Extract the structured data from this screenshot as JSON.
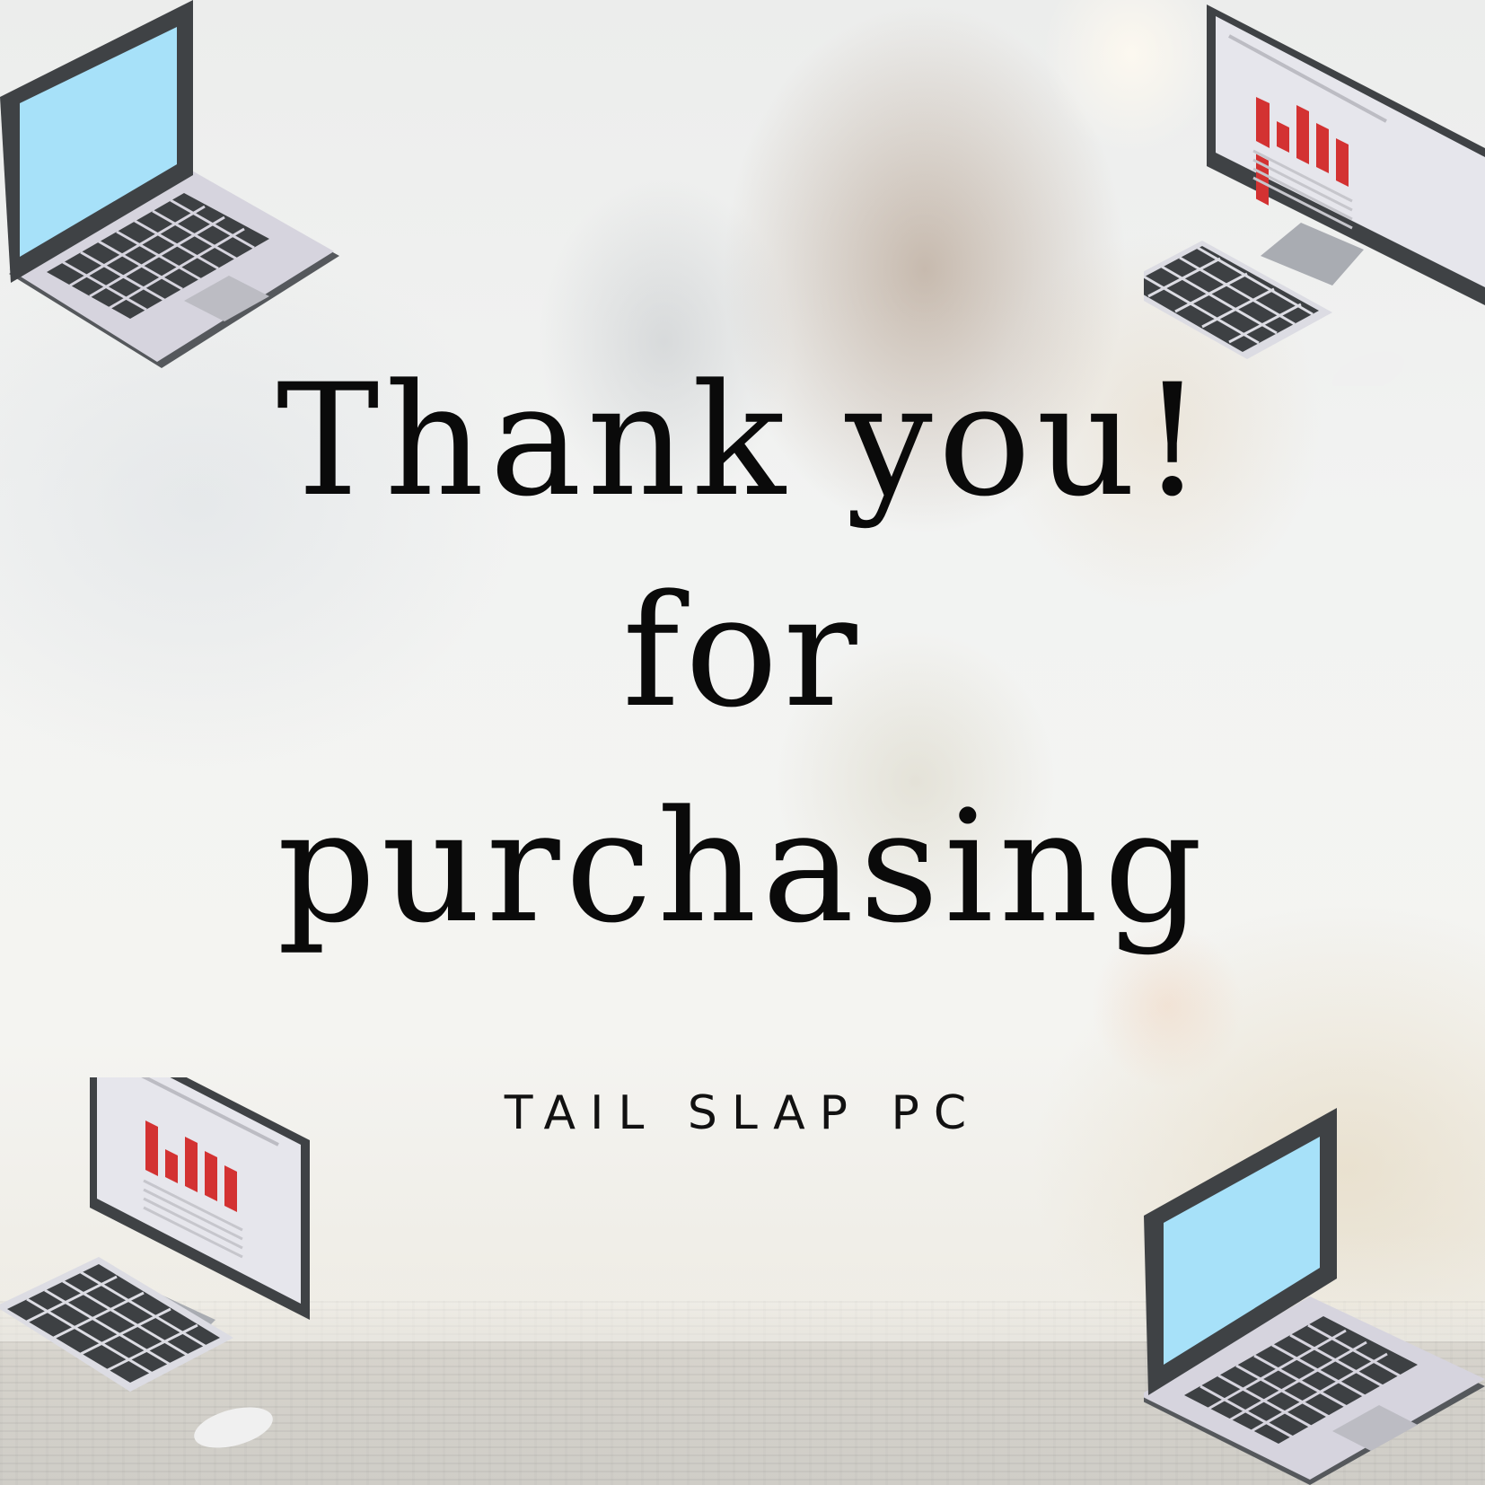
{
  "message": {
    "line1": "Thank you!",
    "line2": "for",
    "line3": "purchasing"
  },
  "brand": "TAIL SLAP PC",
  "colors": {
    "text": "#0a0a0a",
    "laptop_screen": "#a7e1f9",
    "bezel": "#3f4245",
    "chart_bar": "#d33232"
  },
  "illustrations": [
    {
      "icon": "laptop-icon"
    },
    {
      "icon": "desktop-computer-icon"
    },
    {
      "icon": "desktop-computer-icon"
    },
    {
      "icon": "laptop-icon"
    }
  ]
}
